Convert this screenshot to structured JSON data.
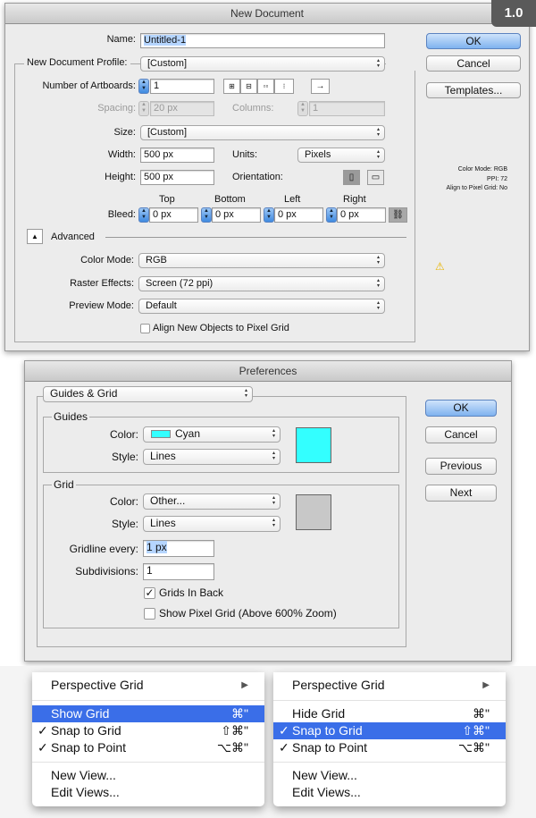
{
  "badge": "1.0",
  "new_doc": {
    "title": "New Document",
    "name_label": "Name:",
    "name_value": "Untitled-1",
    "profile_label": "New Document Profile:",
    "profile_value": "[Custom]",
    "artboards_label": "Number of Artboards:",
    "artboards_value": "1",
    "spacing_label": "Spacing:",
    "spacing_value": "20 px",
    "columns_label": "Columns:",
    "columns_value": "1",
    "size_label": "Size:",
    "size_value": "[Custom]",
    "width_label": "Width:",
    "width_value": "500 px",
    "height_label": "Height:",
    "height_value": "500 px",
    "units_label": "Units:",
    "units_value": "Pixels",
    "orientation_label": "Orientation:",
    "bleed_label": "Bleed:",
    "bleed": {
      "top_label": "Top",
      "bottom_label": "Bottom",
      "left_label": "Left",
      "right_label": "Right",
      "top": "0 px",
      "bottom": "0 px",
      "left": "0 px",
      "right": "0 px"
    },
    "advanced_label": "Advanced",
    "color_mode_label": "Color Mode:",
    "color_mode_value": "RGB",
    "raster_label": "Raster Effects:",
    "raster_value": "Screen (72 ppi)",
    "preview_label": "Preview Mode:",
    "preview_value": "Default",
    "align_label": "Align New Objects to Pixel Grid",
    "ok": "OK",
    "cancel": "Cancel",
    "templates": "Templates...",
    "info": [
      "Color Mode: RGB",
      "PPI: 72",
      "Align to Pixel Grid: No"
    ]
  },
  "prefs": {
    "title": "Preferences",
    "section": "Guides & Grid",
    "guides_label": "Guides",
    "guides_color_label": "Color:",
    "guides_color": "Cyan",
    "guides_style_label": "Style:",
    "guides_style": "Lines",
    "guides_swatch": "#33ffff",
    "grid_label": "Grid",
    "grid_color_label": "Color:",
    "grid_color": "Other...",
    "grid_style_label": "Style:",
    "grid_style": "Lines",
    "grid_swatch": "#c8c8c8",
    "gridline_label": "Gridline every:",
    "gridline_value": "1 px",
    "subdiv_label": "Subdivisions:",
    "subdiv_value": "1",
    "grids_in_back": "Grids In Back",
    "show_pixel_grid": "Show Pixel Grid (Above 600% Zoom)",
    "ok": "OK",
    "cancel": "Cancel",
    "previous": "Previous",
    "next": "Next"
  },
  "menus": [
    {
      "items": [
        {
          "label": "Perspective Grid"
        },
        {
          "label": "Show Grid",
          "shortcut": "⌘\""
        },
        {
          "label": "Snap to Grid",
          "shortcut": "⇧⌘\"",
          "check": "✓"
        },
        {
          "label": "Snap to Point",
          "shortcut": "⌥⌘\"",
          "check": "✓"
        },
        {
          "label": "New View..."
        },
        {
          "label": "Edit Views..."
        }
      ]
    },
    {
      "items": [
        {
          "label": "Perspective Grid"
        },
        {
          "label": "Hide Grid",
          "shortcut": "⌘\""
        },
        {
          "label": "Snap to Grid",
          "shortcut": "⇧⌘\"",
          "check": "✓"
        },
        {
          "label": "Snap to Point",
          "shortcut": "⌥⌘\"",
          "check": "✓"
        },
        {
          "label": "New View..."
        },
        {
          "label": "Edit Views..."
        }
      ]
    }
  ]
}
